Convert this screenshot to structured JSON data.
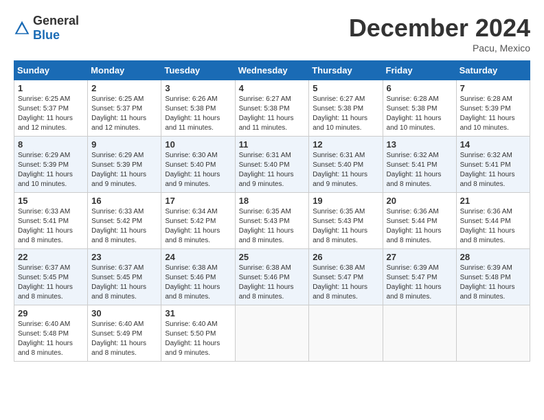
{
  "header": {
    "logo_general": "General",
    "logo_blue": "Blue",
    "title": "December 2024",
    "location": "Pacu, Mexico"
  },
  "calendar": {
    "days_of_week": [
      "Sunday",
      "Monday",
      "Tuesday",
      "Wednesday",
      "Thursday",
      "Friday",
      "Saturday"
    ],
    "weeks": [
      [
        {
          "day": "1",
          "info": "Sunrise: 6:25 AM\nSunset: 5:37 PM\nDaylight: 11 hours and 12 minutes."
        },
        {
          "day": "2",
          "info": "Sunrise: 6:25 AM\nSunset: 5:37 PM\nDaylight: 11 hours and 12 minutes."
        },
        {
          "day": "3",
          "info": "Sunrise: 6:26 AM\nSunset: 5:38 PM\nDaylight: 11 hours and 11 minutes."
        },
        {
          "day": "4",
          "info": "Sunrise: 6:27 AM\nSunset: 5:38 PM\nDaylight: 11 hours and 11 minutes."
        },
        {
          "day": "5",
          "info": "Sunrise: 6:27 AM\nSunset: 5:38 PM\nDaylight: 11 hours and 10 minutes."
        },
        {
          "day": "6",
          "info": "Sunrise: 6:28 AM\nSunset: 5:38 PM\nDaylight: 11 hours and 10 minutes."
        },
        {
          "day": "7",
          "info": "Sunrise: 6:28 AM\nSunset: 5:39 PM\nDaylight: 11 hours and 10 minutes."
        }
      ],
      [
        {
          "day": "8",
          "info": "Sunrise: 6:29 AM\nSunset: 5:39 PM\nDaylight: 11 hours and 10 minutes."
        },
        {
          "day": "9",
          "info": "Sunrise: 6:29 AM\nSunset: 5:39 PM\nDaylight: 11 hours and 9 minutes."
        },
        {
          "day": "10",
          "info": "Sunrise: 6:30 AM\nSunset: 5:40 PM\nDaylight: 11 hours and 9 minutes."
        },
        {
          "day": "11",
          "info": "Sunrise: 6:31 AM\nSunset: 5:40 PM\nDaylight: 11 hours and 9 minutes."
        },
        {
          "day": "12",
          "info": "Sunrise: 6:31 AM\nSunset: 5:40 PM\nDaylight: 11 hours and 9 minutes."
        },
        {
          "day": "13",
          "info": "Sunrise: 6:32 AM\nSunset: 5:41 PM\nDaylight: 11 hours and 8 minutes."
        },
        {
          "day": "14",
          "info": "Sunrise: 6:32 AM\nSunset: 5:41 PM\nDaylight: 11 hours and 8 minutes."
        }
      ],
      [
        {
          "day": "15",
          "info": "Sunrise: 6:33 AM\nSunset: 5:41 PM\nDaylight: 11 hours and 8 minutes."
        },
        {
          "day": "16",
          "info": "Sunrise: 6:33 AM\nSunset: 5:42 PM\nDaylight: 11 hours and 8 minutes."
        },
        {
          "day": "17",
          "info": "Sunrise: 6:34 AM\nSunset: 5:42 PM\nDaylight: 11 hours and 8 minutes."
        },
        {
          "day": "18",
          "info": "Sunrise: 6:35 AM\nSunset: 5:43 PM\nDaylight: 11 hours and 8 minutes."
        },
        {
          "day": "19",
          "info": "Sunrise: 6:35 AM\nSunset: 5:43 PM\nDaylight: 11 hours and 8 minutes."
        },
        {
          "day": "20",
          "info": "Sunrise: 6:36 AM\nSunset: 5:44 PM\nDaylight: 11 hours and 8 minutes."
        },
        {
          "day": "21",
          "info": "Sunrise: 6:36 AM\nSunset: 5:44 PM\nDaylight: 11 hours and 8 minutes."
        }
      ],
      [
        {
          "day": "22",
          "info": "Sunrise: 6:37 AM\nSunset: 5:45 PM\nDaylight: 11 hours and 8 minutes."
        },
        {
          "day": "23",
          "info": "Sunrise: 6:37 AM\nSunset: 5:45 PM\nDaylight: 11 hours and 8 minutes."
        },
        {
          "day": "24",
          "info": "Sunrise: 6:38 AM\nSunset: 5:46 PM\nDaylight: 11 hours and 8 minutes."
        },
        {
          "day": "25",
          "info": "Sunrise: 6:38 AM\nSunset: 5:46 PM\nDaylight: 11 hours and 8 minutes."
        },
        {
          "day": "26",
          "info": "Sunrise: 6:38 AM\nSunset: 5:47 PM\nDaylight: 11 hours and 8 minutes."
        },
        {
          "day": "27",
          "info": "Sunrise: 6:39 AM\nSunset: 5:47 PM\nDaylight: 11 hours and 8 minutes."
        },
        {
          "day": "28",
          "info": "Sunrise: 6:39 AM\nSunset: 5:48 PM\nDaylight: 11 hours and 8 minutes."
        }
      ],
      [
        {
          "day": "29",
          "info": "Sunrise: 6:40 AM\nSunset: 5:48 PM\nDaylight: 11 hours and 8 minutes."
        },
        {
          "day": "30",
          "info": "Sunrise: 6:40 AM\nSunset: 5:49 PM\nDaylight: 11 hours and 8 minutes."
        },
        {
          "day": "31",
          "info": "Sunrise: 6:40 AM\nSunset: 5:50 PM\nDaylight: 11 hours and 9 minutes."
        },
        {
          "day": "",
          "info": ""
        },
        {
          "day": "",
          "info": ""
        },
        {
          "day": "",
          "info": ""
        },
        {
          "day": "",
          "info": ""
        }
      ]
    ]
  }
}
